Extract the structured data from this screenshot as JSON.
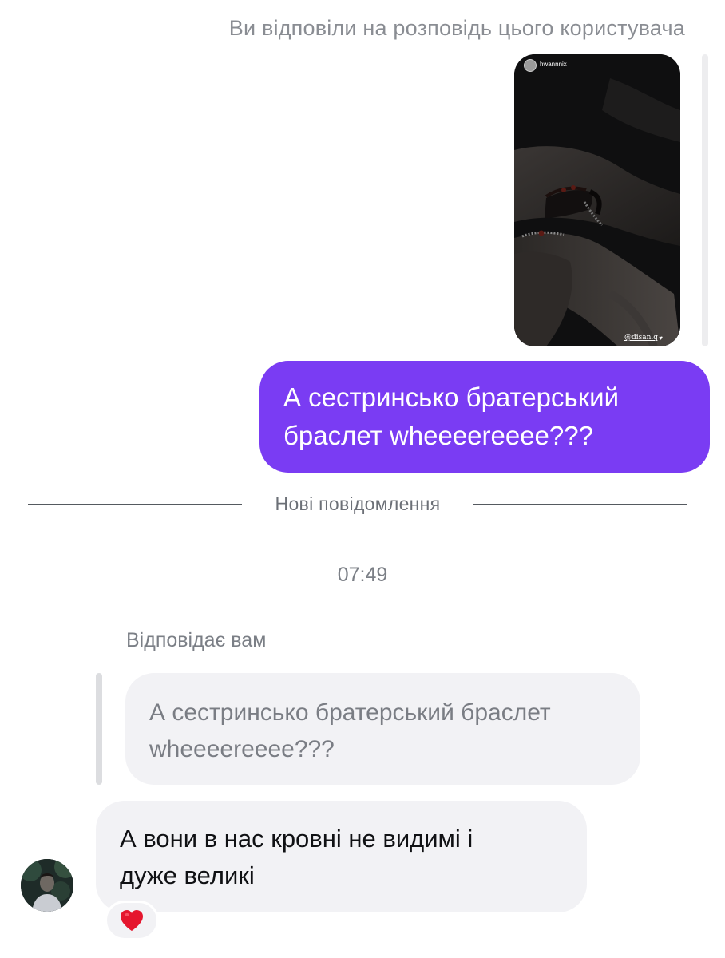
{
  "conversation": {
    "story_reply_caption": "Ви відповіли на розповідь цього користувача",
    "story": {
      "username": "hwannnix",
      "credit": "@disan.q"
    },
    "outgoing_message": {
      "line1": "А сестринсько братерський",
      "line2": "браслет wheeeereeee???"
    },
    "new_messages_label": "Нові повідомлення",
    "timestamp": "07:49",
    "replying_caption": "Відповідає вам",
    "quoted_message": {
      "line1": "А сестринсько братерський браслет",
      "line2": "wheeeereeee???"
    },
    "incoming_message": {
      "line1": "А вони в нас кровні не видимі і",
      "line2": "дуже великі"
    },
    "reaction": {
      "icon": "heart-icon",
      "color": "#e5162e"
    }
  },
  "colors": {
    "outgoing_bubble": "#7a3cf3",
    "incoming_bubble": "#f2f2f5"
  }
}
